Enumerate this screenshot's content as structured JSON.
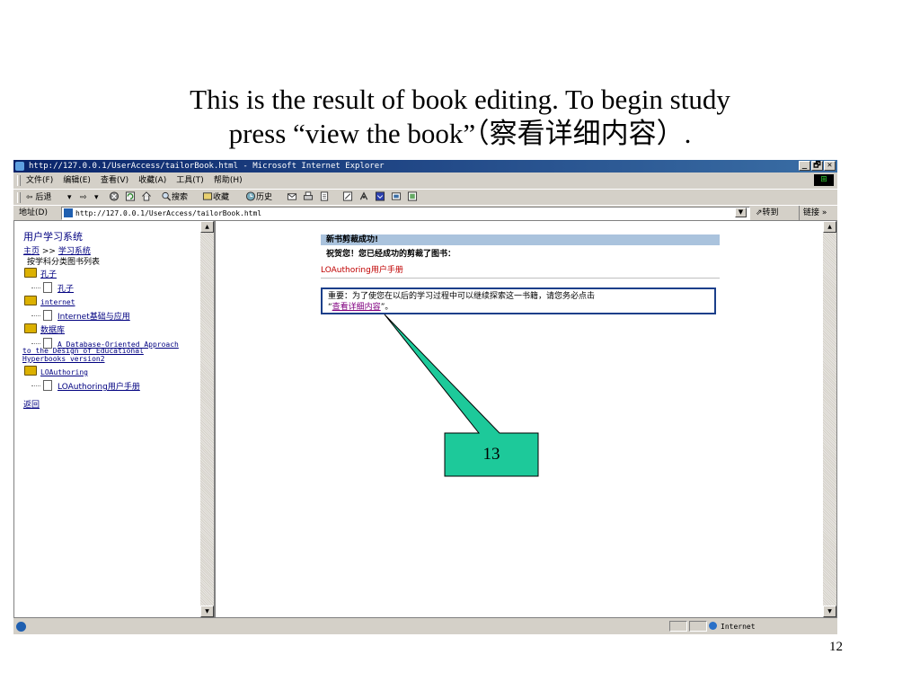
{
  "slide": {
    "title_line1": "This is the result of book editing. To begin study",
    "title_line2": "press “view the book”（察看详细内容）.",
    "page_number": "12",
    "callout_number": "13"
  },
  "browser": {
    "window_title": "http://127.0.0.1/UserAccess/tailorBook.html - Microsoft Internet Explorer",
    "window_buttons": [
      "_",
      "🗗",
      "✕"
    ],
    "menu": [
      "文件(F)",
      "编辑(E)",
      "查看(V)",
      "收藏(A)",
      "工具(T)",
      "帮助(H)"
    ],
    "toolbar": {
      "back": "⇦ 后退",
      "back_drop": "▾",
      "forward": "⇨",
      "forward_drop": "▾",
      "search": "搜索",
      "favorites": "收藏",
      "history": "历史"
    },
    "address_label": "地址(D)",
    "address_value": "http://127.0.0.1/UserAccess/tailorBook.html",
    "go_label": "转到",
    "links_label": "链接 »",
    "status_zone": "Internet"
  },
  "left_frame": {
    "heading": "用户学习系统",
    "breadcrumb_home": "主页",
    "breadcrumb_sep": ">>",
    "breadcrumb_current": "学习系统",
    "subtitle": "按学科分类图书列表",
    "tree": [
      {
        "folder": "孔子",
        "docs": [
          "孔子"
        ]
      },
      {
        "folder": "internet",
        "docs": [
          "Internet基础与应用"
        ]
      },
      {
        "folder": "数据库",
        "docs": [
          "A Database-Oriented Approach",
          "to the Design of Educational",
          "Hyperbooks version2"
        ]
      },
      {
        "folder": "LOAuthoring",
        "docs": [
          "LOAuthoring用户手册"
        ]
      }
    ],
    "back_link": "返回"
  },
  "right_frame": {
    "notice_header": "新书剪裁成功!",
    "notice_message": "祝贺您！您已经成功的剪裁了图书：",
    "book_title": "LOAuthoring用户手册",
    "tip_prefix": "重要：为了使您在以后的学习过程中可以继续探索这一书籍，请您务必点击",
    "tip_open_quote": "“",
    "tip_link": "查看详细内容",
    "tip_suffix": "”。"
  },
  "colors": {
    "titlebar": "#0a246a",
    "notice_header_bg": "#aac3dd",
    "callout_fill": "#1dc99a",
    "book_title": "#c00000"
  }
}
